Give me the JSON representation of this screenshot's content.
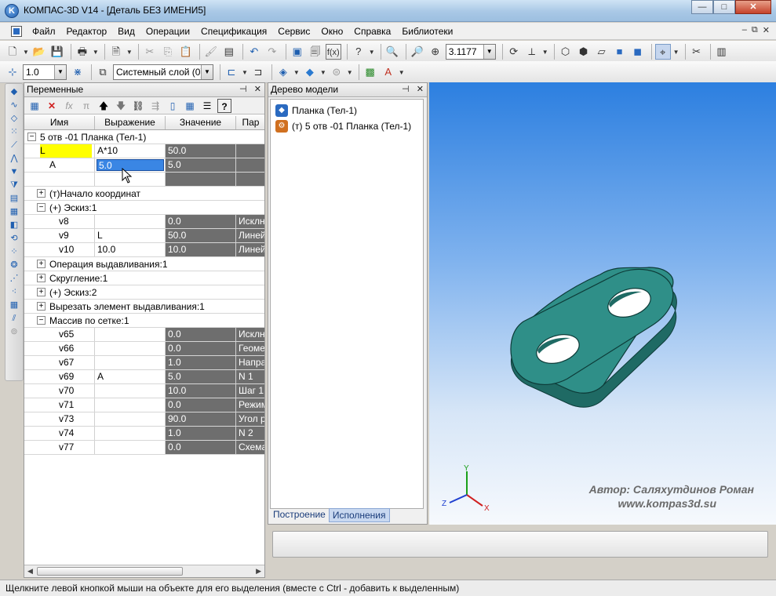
{
  "window": {
    "title": "КОМПАС-3D V14 - [Деталь БЕЗ ИМЕНИ5]",
    "minimize": "—",
    "maximize": "□",
    "close": "✕"
  },
  "menu": {
    "items": [
      "Файл",
      "Редактор",
      "Вид",
      "Операции",
      "Спецификация",
      "Сервис",
      "Окно",
      "Справка",
      "Библиотеки"
    ],
    "mdi": [
      "–",
      "⧉",
      "✕"
    ]
  },
  "toolbar1": {
    "zoom_value": "3.1177"
  },
  "toolbar2": {
    "step_value": "1.0",
    "layer_value": "Системный слой (0)"
  },
  "variables_panel": {
    "title": "Переменные",
    "columns": [
      "Имя",
      "Выражение",
      "Значение",
      "Пар"
    ],
    "root_label": "5 отв -01 Планка (Тел-1)",
    "top_rows": [
      {
        "name": "L",
        "expression": "A*10",
        "value": "50.0",
        "param": ""
      },
      {
        "name": "A",
        "expression": "5.0",
        "value": "5.0",
        "param": ""
      },
      {
        "name": "",
        "expression": "",
        "value": "",
        "param": ""
      }
    ],
    "group_origin": "(т)Начало координат",
    "group_sketch1": "(+) Эскиз:1",
    "sketch1_rows": [
      {
        "name": "v8",
        "expression": "",
        "value": "0.0",
        "param": "Исклн"
      },
      {
        "name": "v9",
        "expression": "L",
        "value": "50.0",
        "param": "Линей"
      },
      {
        "name": "v10",
        "expression": "10.0",
        "value": "10.0",
        "param": "Линей"
      }
    ],
    "group_extrude": "Операция выдавливания:1",
    "group_fillet": "Скругление:1",
    "group_sketch2": "(+) Эскиз:2",
    "group_cut": "Вырезать элемент выдавливания:1",
    "group_array": "Массив по сетке:1",
    "array_rows": [
      {
        "name": "v65",
        "expression": "",
        "value": "0.0",
        "param": "Исклн"
      },
      {
        "name": "v66",
        "expression": "",
        "value": "0.0",
        "param": "Геоме"
      },
      {
        "name": "v67",
        "expression": "",
        "value": "1.0",
        "param": "Напра"
      },
      {
        "name": "v69",
        "expression": "A",
        "value": "5.0",
        "param": "N 1"
      },
      {
        "name": "v70",
        "expression": "",
        "value": "10.0",
        "param": "Шаг 1"
      },
      {
        "name": "v71",
        "expression": "",
        "value": "0.0",
        "param": "Режим"
      },
      {
        "name": "v73",
        "expression": "",
        "value": "90.0",
        "param": "Угол р"
      },
      {
        "name": "v74",
        "expression": "",
        "value": "1.0",
        "param": "N 2"
      },
      {
        "name": "v77",
        "expression": "",
        "value": "0.0",
        "param": "Схема"
      }
    ],
    "pin": "📌",
    "close": "✕"
  },
  "tree_panel": {
    "title": "Дерево модели",
    "items": [
      "Планка (Тел-1)",
      "(т) 5 отв -01 Планка (Тел-1)"
    ],
    "tabs": [
      "Построение",
      "Исполнения"
    ]
  },
  "viewport": {
    "author_line1": "Автор: Саляхутдинов Роман",
    "author_line2": "www.kompas3d.su",
    "axis_y": "Y",
    "axis_z": "Z",
    "axis_x": "X",
    "part_color": "#2f8f88"
  },
  "statusbar": {
    "text": "Щелкните левой кнопкой мыши на объекте для его выделения (вместе с Ctrl - добавить к выделенным)"
  }
}
